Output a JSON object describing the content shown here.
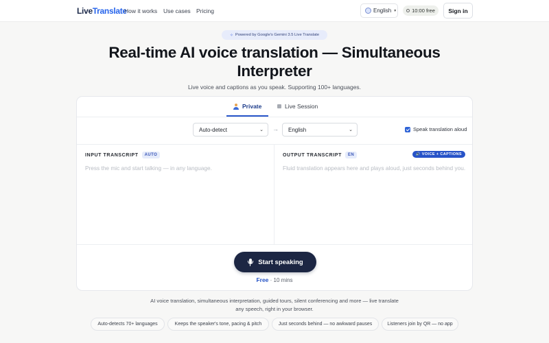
{
  "header": {
    "logo_main": "Live",
    "logo_accent": "Translate",
    "nav": [
      "How it works",
      "Use cases",
      "Pricing"
    ],
    "language": "English",
    "timer": "10:00 free",
    "signin": "Sign in"
  },
  "hero": {
    "pill_icon": "✧",
    "pill": "Powered by Google's Gemini 3.5 Live Translate",
    "title": "Real-time AI voice translation — Simultaneous Interpreter",
    "subtitle": "Live voice and captions as you speak. Supporting 100+ languages."
  },
  "tabs": [
    "Private",
    "Live Session"
  ],
  "controls": {
    "source": "Auto-detect",
    "target": "English",
    "arrow": "→",
    "speak_aloud": "Speak translation aloud",
    "speak_aloud_checked": true
  },
  "input_pane": {
    "title": "INPUT TRANSCRIPT",
    "badge": "AUTO",
    "placeholder": "Press the mic and start talking — in any language."
  },
  "output_pane": {
    "title": "OUTPUT TRANSCRIPT",
    "badge": "EN",
    "mode_badge": "🔊 VOICE + CAPTIONS",
    "placeholder": "Fluid translation appears here and plays aloud, just seconds behind you."
  },
  "cta": {
    "button": "Start speaking",
    "free": "Free",
    "duration": "· 10 mins"
  },
  "bottom": {
    "text": "AI voice translation, simultaneous interpretation, guided tours, silent conferencing and more — live translate any speech, right in your browser.",
    "chips": [
      "Auto-detects 70+ languages",
      "Keeps the speaker's tone, pacing & pitch",
      "Just seconds behind — no awkward pauses",
      "Listeners join by QR — no app"
    ]
  },
  "colors": {
    "accent": "#2754c9",
    "button_dark": "#1c2643",
    "background": "#f7f7f6"
  },
  "icons": [
    "globe-icon",
    "timer-icon",
    "person-icon",
    "session-icon",
    "checkbox-icon",
    "mic-icon",
    "speaker-icon",
    "sparkle-icon"
  ]
}
